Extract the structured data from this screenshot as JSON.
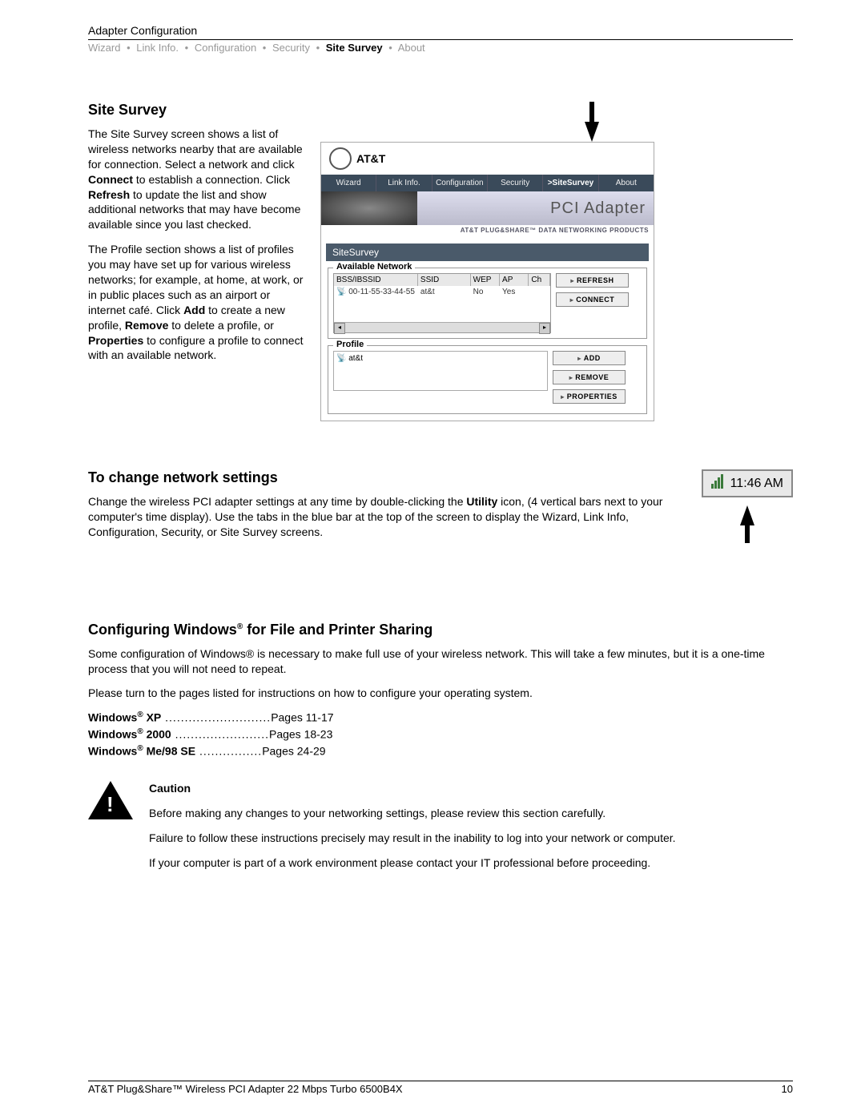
{
  "header": {
    "title": "Adapter Configuration"
  },
  "breadcrumbs": {
    "items": [
      "Wizard",
      "Link Info.",
      "Configuration",
      "Security",
      "Site Survey",
      "About"
    ],
    "active": "Site Survey",
    "sep": "•"
  },
  "section_site_survey": {
    "heading": "Site Survey",
    "para1_a": "The Site Survey screen shows a list of wireless networks nearby that are available for connection. Select a network and click ",
    "para1_b": "Connect",
    "para1_c": " to establish a connection. Click ",
    "para1_d": "Refresh",
    "para1_e": " to update the list and show additional networks that may have become available since you last checked.",
    "para2_a": "The Profile section shows a list of profiles you may have set up for various wireless networks; for example, at home, at work, or in public places such as an airport or internet café. Click ",
    "para2_b": "Add",
    "para2_c": " to create a new profile, ",
    "para2_d": "Remove",
    "para2_e": " to delete a profile, or ",
    "para2_f": "Properties",
    "para2_g": " to configure a profile to connect with an available network."
  },
  "app": {
    "logo": "AT&T",
    "tabs": [
      "Wizard",
      "Link Info.",
      "Configuration",
      "Security",
      ">SiteSurvey",
      "About"
    ],
    "banner_title": "PCI Adapter",
    "banner_sub": "AT&T PLUG&SHARE™ DATA NETWORKING PRODUCTS",
    "screen_title": "SiteSurvey",
    "available_network": {
      "legend": "Available Network",
      "columns": [
        "BSS/IBSSID",
        "SSID",
        "WEP",
        "AP",
        "Ch"
      ],
      "row": {
        "bss": "00-11-55-33-44-55",
        "ssid": "at&t",
        "wep": "No",
        "ap": "Yes",
        "ch": ""
      }
    },
    "buttons_top": [
      "REFRESH",
      "CONNECT"
    ],
    "profile": {
      "legend": "Profile",
      "item": "at&t",
      "buttons": [
        "ADD",
        "REMOVE",
        "PROPERTIES"
      ]
    }
  },
  "section_change": {
    "heading": "To change network settings",
    "para_a": "Change the wireless PCI adapter settings at any time by double-clicking the ",
    "para_b": "Utility",
    "para_c": " icon, (4 vertical bars next to your computer's time display). Use the tabs in the blue bar at the top of the screen to display the Wizard, Link Info, Configuration, Security, or Site Survey screens.",
    "tray_time": "11:46 AM"
  },
  "section_config": {
    "heading_a": "Configuring Windows",
    "heading_reg": "®",
    "heading_b": " for File and Printer Sharing",
    "para1": "Some configuration of Windows® is necessary to make full use of your wireless network. This will take a few minutes, but it is a one-time process that you will not need to repeat.",
    "para2": "Please turn to the pages listed for instructions on how to configure your operating system.",
    "rows": [
      {
        "os_a": "Windows",
        "os_reg": "®",
        "os_b": " XP",
        "dots": " ...........................",
        "pages": "Pages 11-17"
      },
      {
        "os_a": "Windows",
        "os_reg": "®",
        "os_b": " 2000",
        "dots": " ........................",
        "pages": "Pages 18-23"
      },
      {
        "os_a": "Windows",
        "os_reg": "®",
        "os_b": " Me/98 SE",
        "dots": " ................",
        "pages": "Pages 24-29"
      }
    ]
  },
  "caution": {
    "heading": "Caution",
    "p1": "Before making any changes to your networking settings, please review this section carefully.",
    "p2": "Failure to follow these instructions precisely may result in the inability to log into your network or computer.",
    "p3": "If your computer is part of a work environment please contact your IT professional before proceeding."
  },
  "footer": {
    "left": "AT&T Plug&Share™ Wireless PCI Adapter 22 Mbps Turbo 6500B4X",
    "right": "10"
  }
}
